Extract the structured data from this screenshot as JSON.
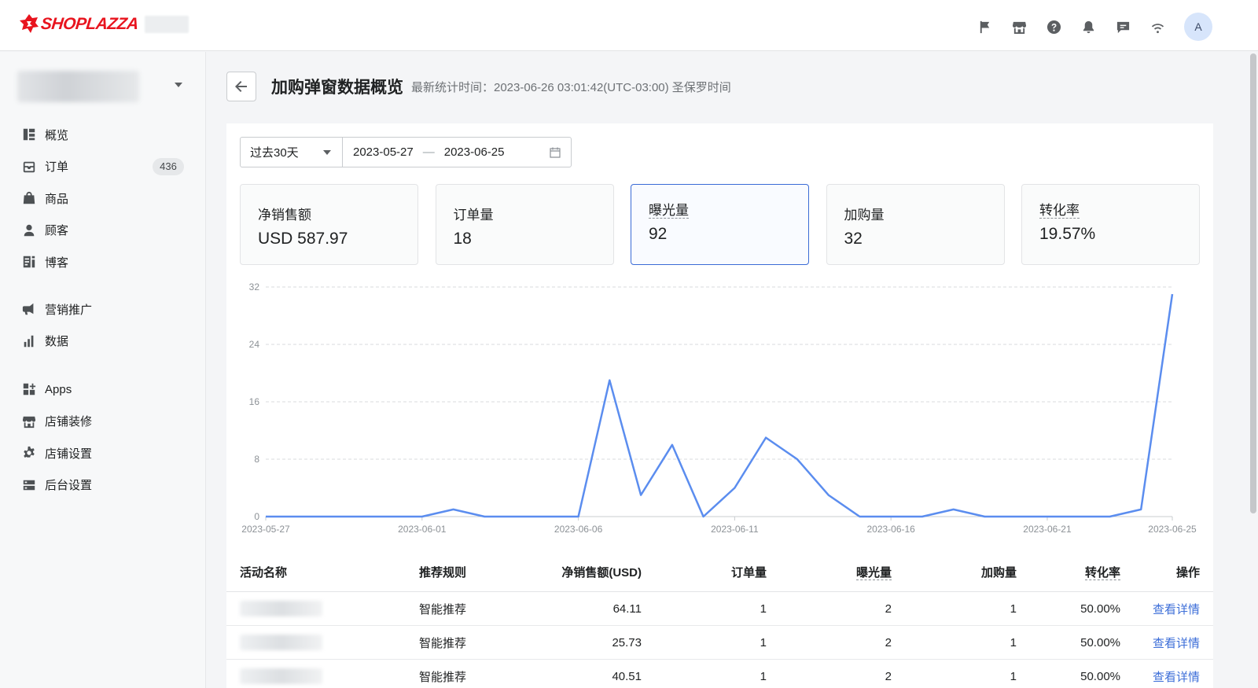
{
  "brand": {
    "name": "SHOPLAZZA",
    "accent": "#e8141e"
  },
  "topbar": {
    "icons": [
      "flag-icon",
      "store-icon",
      "help-icon",
      "bell-icon",
      "message-icon",
      "wifi-icon"
    ],
    "avatar_letter": "A"
  },
  "sidebar": {
    "items": [
      {
        "label": "概览",
        "icon": "dashboard-icon"
      },
      {
        "label": "订单",
        "icon": "inbox-icon",
        "badge": "436"
      },
      {
        "label": "商品",
        "icon": "bag-icon"
      },
      {
        "label": "顾客",
        "icon": "person-icon"
      },
      {
        "label": "博客",
        "icon": "blog-icon"
      },
      {
        "label": "营销推广",
        "icon": "megaphone-icon"
      },
      {
        "label": "数据",
        "icon": "bar-chart-icon"
      },
      {
        "label": "Apps",
        "icon": "apps-icon"
      },
      {
        "label": "店铺装修",
        "icon": "storefront-icon"
      },
      {
        "label": "店铺设置",
        "icon": "gear-icon"
      },
      {
        "label": "后台设置",
        "icon": "server-icon"
      }
    ]
  },
  "header": {
    "title": "加购弹窗数据概览",
    "stat_time": "最新统计时间：2023-06-26 03:01:42(UTC-03:00) 圣保罗时间"
  },
  "filter": {
    "range": "过去30天",
    "start_date": "2023-05-27",
    "end_date": "2023-06-25",
    "separator": "—"
  },
  "kpis": [
    {
      "label": "净销售额",
      "value": "USD 587.97"
    },
    {
      "label": "订单量",
      "value": "18"
    },
    {
      "label": "曝光量",
      "value": "92",
      "selected": true
    },
    {
      "label": "加购量",
      "value": "32"
    },
    {
      "label": "转化率",
      "value": "19.57%"
    }
  ],
  "chart_data": {
    "type": "line",
    "line_color": "#5b8def",
    "x": [
      "2023-05-27",
      "2023-05-28",
      "2023-05-29",
      "2023-05-30",
      "2023-05-31",
      "2023-06-01",
      "2023-06-02",
      "2023-06-03",
      "2023-06-04",
      "2023-06-05",
      "2023-06-06",
      "2023-06-07",
      "2023-06-08",
      "2023-06-09",
      "2023-06-10",
      "2023-06-11",
      "2023-06-12",
      "2023-06-13",
      "2023-06-14",
      "2023-06-15",
      "2023-06-16",
      "2023-06-17",
      "2023-06-18",
      "2023-06-19",
      "2023-06-20",
      "2023-06-21",
      "2023-06-22",
      "2023-06-23",
      "2023-06-24",
      "2023-06-25"
    ],
    "values": [
      0,
      0,
      0,
      0,
      0,
      0,
      1,
      0,
      0,
      0,
      0,
      19,
      3,
      10,
      0,
      4,
      11,
      8,
      3,
      0,
      0,
      0,
      1,
      0,
      0,
      0,
      0,
      0,
      1,
      31
    ],
    "x_ticks": [
      "2023-05-27",
      "2023-06-01",
      "2023-06-06",
      "2023-06-11",
      "2023-06-16",
      "2023-06-21",
      "2023-06-25"
    ],
    "y_ticks": [
      0,
      8,
      16,
      24,
      32
    ],
    "ylim": [
      0,
      32
    ],
    "grid": "horizontal-dashed"
  },
  "table": {
    "headers": [
      "活动名称",
      "推荐规则",
      "净销售额(USD)",
      "订单量",
      "曝光量",
      "加购量",
      "转化率",
      "操作"
    ],
    "rows": [
      {
        "rule": "智能推荐",
        "sales": "64.11",
        "orders": "1",
        "views": "2",
        "adds": "1",
        "rate": "50.00%",
        "action": "查看详情"
      },
      {
        "rule": "智能推荐",
        "sales": "25.73",
        "orders": "1",
        "views": "2",
        "adds": "1",
        "rate": "50.00%",
        "action": "查看详情"
      },
      {
        "rule": "智能推荐",
        "sales": "40.51",
        "orders": "1",
        "views": "2",
        "adds": "1",
        "rate": "50.00%",
        "action": "查看详情"
      }
    ]
  }
}
